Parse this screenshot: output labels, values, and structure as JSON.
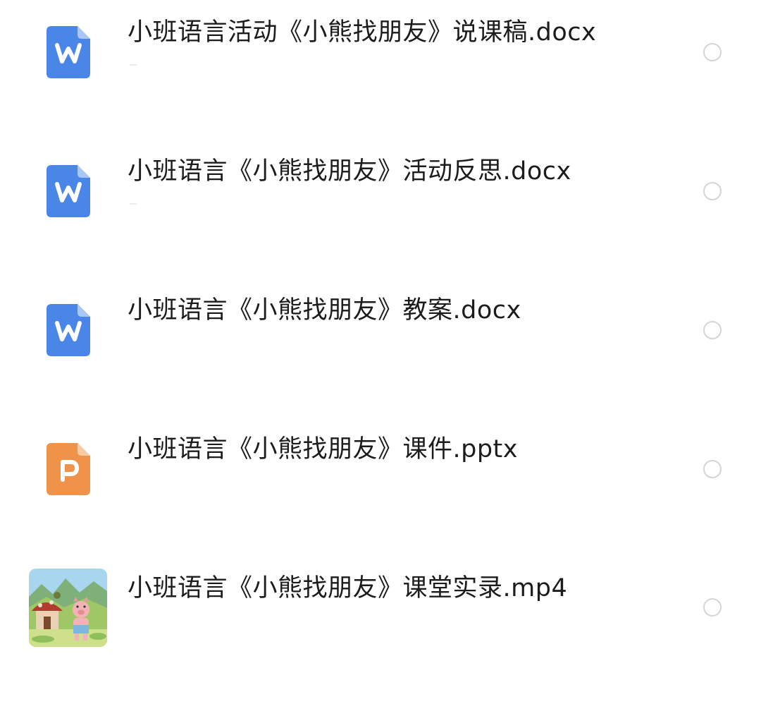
{
  "files": [
    {
      "name": "小班语言活动《小熊找朋友》说课稿.docx",
      "type": "docx",
      "icon": "word-doc-icon",
      "icon_letter": "W",
      "color": "#4a86e8",
      "selected": false
    },
    {
      "name": "小班语言《小熊找朋友》活动反思.docx",
      "type": "docx",
      "icon": "word-doc-icon",
      "icon_letter": "W",
      "color": "#4a86e8",
      "selected": false
    },
    {
      "name": "小班语言《小熊找朋友》教案.docx",
      "type": "docx",
      "icon": "word-doc-icon",
      "icon_letter": "W",
      "color": "#4a86e8",
      "selected": false
    },
    {
      "name": "小班语言《小熊找朋友》课件.pptx",
      "type": "pptx",
      "icon": "powerpoint-icon",
      "icon_letter": "P",
      "color": "#f0934a",
      "selected": false
    },
    {
      "name": "小班语言《小熊找朋友》课堂实录.mp4",
      "type": "mp4",
      "icon": "video-thumbnail",
      "selected": false
    }
  ],
  "colors": {
    "word": "#4a86e8",
    "powerpoint": "#f0934a",
    "circle_border": "#d5d5d5",
    "text": "#1c1c1c"
  }
}
